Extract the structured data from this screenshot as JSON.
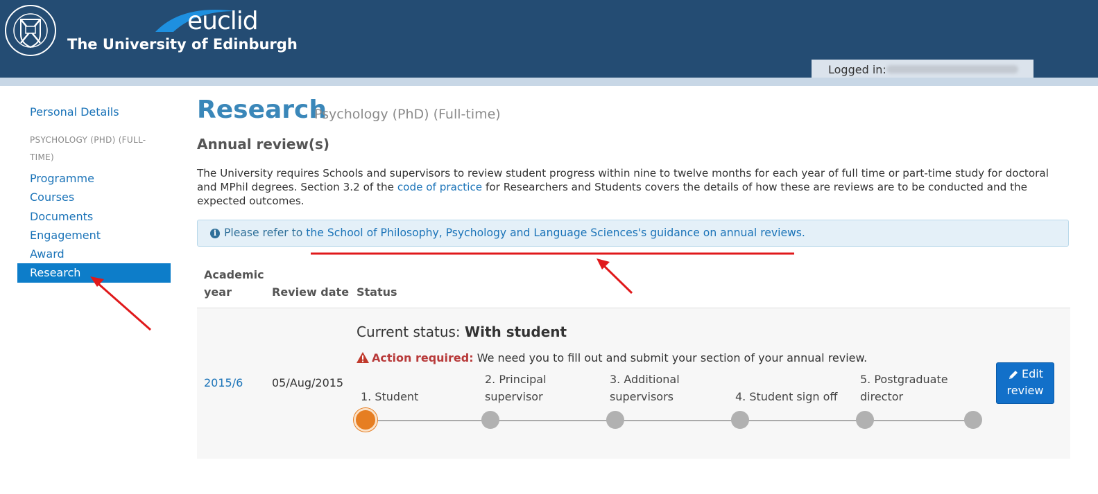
{
  "header": {
    "brand_name": "euclid",
    "university": "The University of Edinburgh",
    "logged_in_label": "Logged in:"
  },
  "sidebar": {
    "personal_details": "Personal Details",
    "section_label": "PSYCHOLOGY (PHD) (FULL-TIME)",
    "items": [
      {
        "label": "Programme"
      },
      {
        "label": "Courses"
      },
      {
        "label": "Documents"
      },
      {
        "label": "Engagement"
      },
      {
        "label": "Award"
      },
      {
        "label": "Research",
        "active": true
      }
    ]
  },
  "main": {
    "title": "Research",
    "subtitle": "Psychology (PhD) (Full-time)",
    "heading": "Annual review(s)",
    "intro_before_link": "The University requires Schools and supervisors to review student progress within nine to twelve months for each year of full time or part-time study for doctoral and MPhil degrees. Section 3.2 of the ",
    "intro_link": "code of practice",
    "intro_after_link": " for Researchers and Students covers the details of how these are reviews are to be conducted and the expected outcomes.",
    "info_prefix": "Please refer to ",
    "info_link": "the School of Philosophy, Psychology and Language Sciences's guidance on annual reviews.",
    "table": {
      "columns": [
        "Academic year",
        "Review date",
        "Status"
      ],
      "rows": [
        {
          "year": "2015/6",
          "date": "05/Aug/2015",
          "status_prefix": "Current status: ",
          "status_value": "With student",
          "action_label": "Action required:",
          "action_text": " We need you to fill out and submit your section of your annual review.",
          "steps": [
            "1. Student",
            "2. Principal supervisor",
            "3. Additional supervisors",
            "4. Student sign off",
            "5. Postgraduate director"
          ],
          "current_step": 1,
          "edit_label_1": "Edit",
          "edit_label_2": "review"
        }
      ]
    }
  },
  "colors": {
    "header": "#244c73",
    "link": "#1a73b8",
    "active_nav": "#0d7dc9",
    "current_step": "#e67e22",
    "pending_step": "#b1b1b1",
    "annotation": "#e0191b"
  },
  "icons": [
    "university-crest-icon",
    "info-icon",
    "warning-icon",
    "pencil-icon"
  ]
}
